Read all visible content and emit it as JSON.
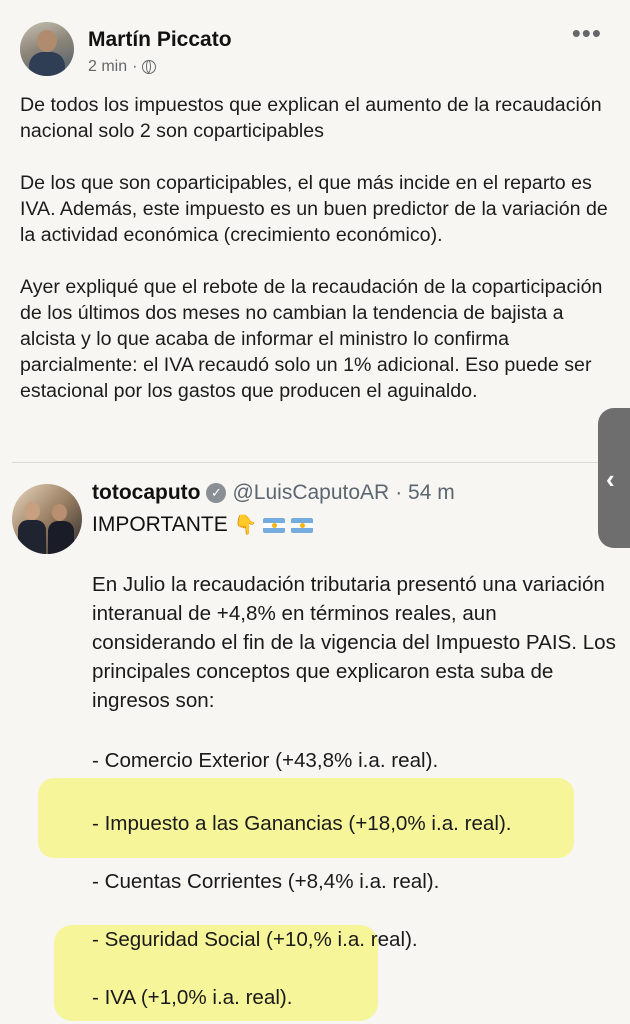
{
  "post": {
    "author": "Martín Piccato",
    "time": "2 min",
    "separator": "·",
    "more_icon": "more-dots-icon",
    "paragraphs": [
      "De todos los impuestos que explican el aumento de la recaudación nacional solo 2 son coparticipables",
      "De los que son coparticipables, el que más incide en el reparto es IVA. Además, este impuesto es un buen predictor de la variación de la actividad económica (crecimiento económico).",
      "Ayer expliqué que el rebote de la recaudación de la coparticipación de los últimos dos meses no cambian la tendencia de bajista a alcista y lo que acaba de informar el ministro lo confirma parcialmente: el IVA recaudó solo un 1% adicional. Eso puede ser estacional por los gastos que producen el aguinaldo."
    ]
  },
  "tweet": {
    "name": "totocaputo",
    "handle": "@LuisCaputoAR",
    "time": "· 54 m",
    "headline": "IMPORTANTE",
    "body": "En Julio la recaudación tributaria presentó una variación interanual de +4,8% en términos reales, aun considerando el fin de la vigencia del Impuesto PAIS. Los principales conceptos que explicaron esta suba de ingresos son:",
    "items": [
      "- Comercio Exterior (+43,8% i.a. real).",
      "- Impuesto a las Ganancias (+18,0% i.a. real).",
      "- Cuentas Corrientes (+8,4% i.a. real).",
      "- Seguridad Social (+10,% i.a. real).",
      "- IVA (+1,0% i.a. real)."
    ]
  },
  "side_tab": {
    "glyph": "‹"
  },
  "colors": {
    "highlight": "#f6f59a",
    "background": "#f7f6f3",
    "secondary_text": "#65676b"
  }
}
